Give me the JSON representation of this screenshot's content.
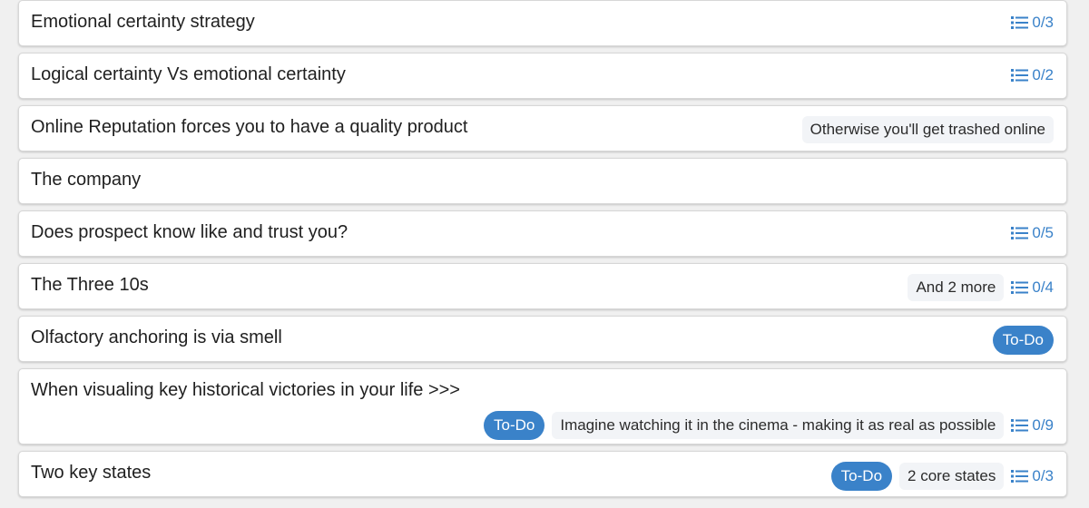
{
  "colors": {
    "accent": "#3a82c9",
    "card_bg": "#ffffff",
    "note_bg": "#f2f4f7",
    "page_bg": "#f0f0f0"
  },
  "cards": [
    {
      "title": "Emotional certainty strategy",
      "checklist": "0/3"
    },
    {
      "title": "Logical certainty Vs emotional certainty",
      "checklist": "0/2"
    },
    {
      "title": "Online Reputation forces you to have a quality product",
      "note": "Otherwise you'll get trashed online"
    },
    {
      "title": "The company"
    },
    {
      "title": "Does prospect know like and trust you?",
      "checklist": "0/5"
    },
    {
      "title": "The Three 10s",
      "note": "And 2 more",
      "checklist": "0/4"
    },
    {
      "title": "Olfactory anchoring is via smell",
      "todo": "To-Do"
    },
    {
      "title": "When visualing key historical victories in your life >>>",
      "todo": "To-Do",
      "note": "Imagine watching it in the cinema - making it as real as possible",
      "checklist": "0/9"
    },
    {
      "title": "Two key states",
      "todo": "To-Do",
      "note": "2 core states",
      "checklist": "0/3"
    }
  ],
  "icons": {
    "checklist": "list-icon"
  }
}
